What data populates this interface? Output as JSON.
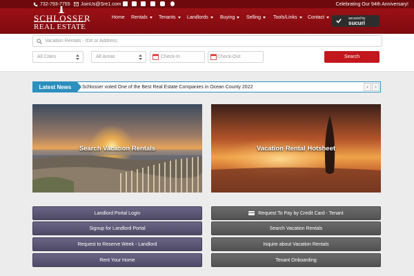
{
  "topbar": {
    "phone": "732-793-7755",
    "email": "JoinUs@Sre1.com",
    "social_icons": [
      "facebook-icon",
      "twitter-icon",
      "linkedin-icon",
      "instagram-icon",
      "youtube-icon",
      "yelp-icon"
    ],
    "anniversary": "Celebrating Our 94th Anniversary!"
  },
  "header": {
    "logo_top": "SCHLOSSER",
    "logo_bottom": "REAL ESTATE",
    "nav": [
      {
        "label": "Home",
        "dropdown": false
      },
      {
        "label": "Rentals",
        "dropdown": true
      },
      {
        "label": "Tenants",
        "dropdown": true
      },
      {
        "label": "Landlords",
        "dropdown": true
      },
      {
        "label": "Buying",
        "dropdown": true
      },
      {
        "label": "Selling",
        "dropdown": true
      },
      {
        "label": "Tools/Links",
        "dropdown": true
      },
      {
        "label": "Contact",
        "dropdown": true
      }
    ],
    "sucuri_line1": "secured by",
    "sucuri_line2": "sucuri"
  },
  "search": {
    "placeholder": "Vacation Rentals - ID# or Address",
    "cities": "All Cities",
    "areas": "All Areas",
    "checkin": "Check-In",
    "checkout": "Check-Out",
    "button": "Search"
  },
  "news": {
    "label": "Latest News",
    "text": "Schlosser voted One of the Best Real Estate Companies in Ocean County 2022",
    "prev": "‹",
    "next": "›"
  },
  "cards": {
    "left_title": "Search Vacation Rentals",
    "right_title": "Vacation Rental Hotsheet"
  },
  "buttons": {
    "left": [
      "Landlord Portal Login",
      "Signup for Landlord Portal",
      "Request to Reserve Week - Landlord",
      "Rent Your Home"
    ],
    "right": [
      "Request To Pay by Credit Card - Tenant",
      "Search Vacation Rentals",
      "Inquire about Vacation Rentals",
      "Tenant Onboarding"
    ]
  },
  "colors": {
    "brand_red": "#9c1015",
    "news_blue": "#2c8fbd",
    "search_red": "#c2171c"
  }
}
